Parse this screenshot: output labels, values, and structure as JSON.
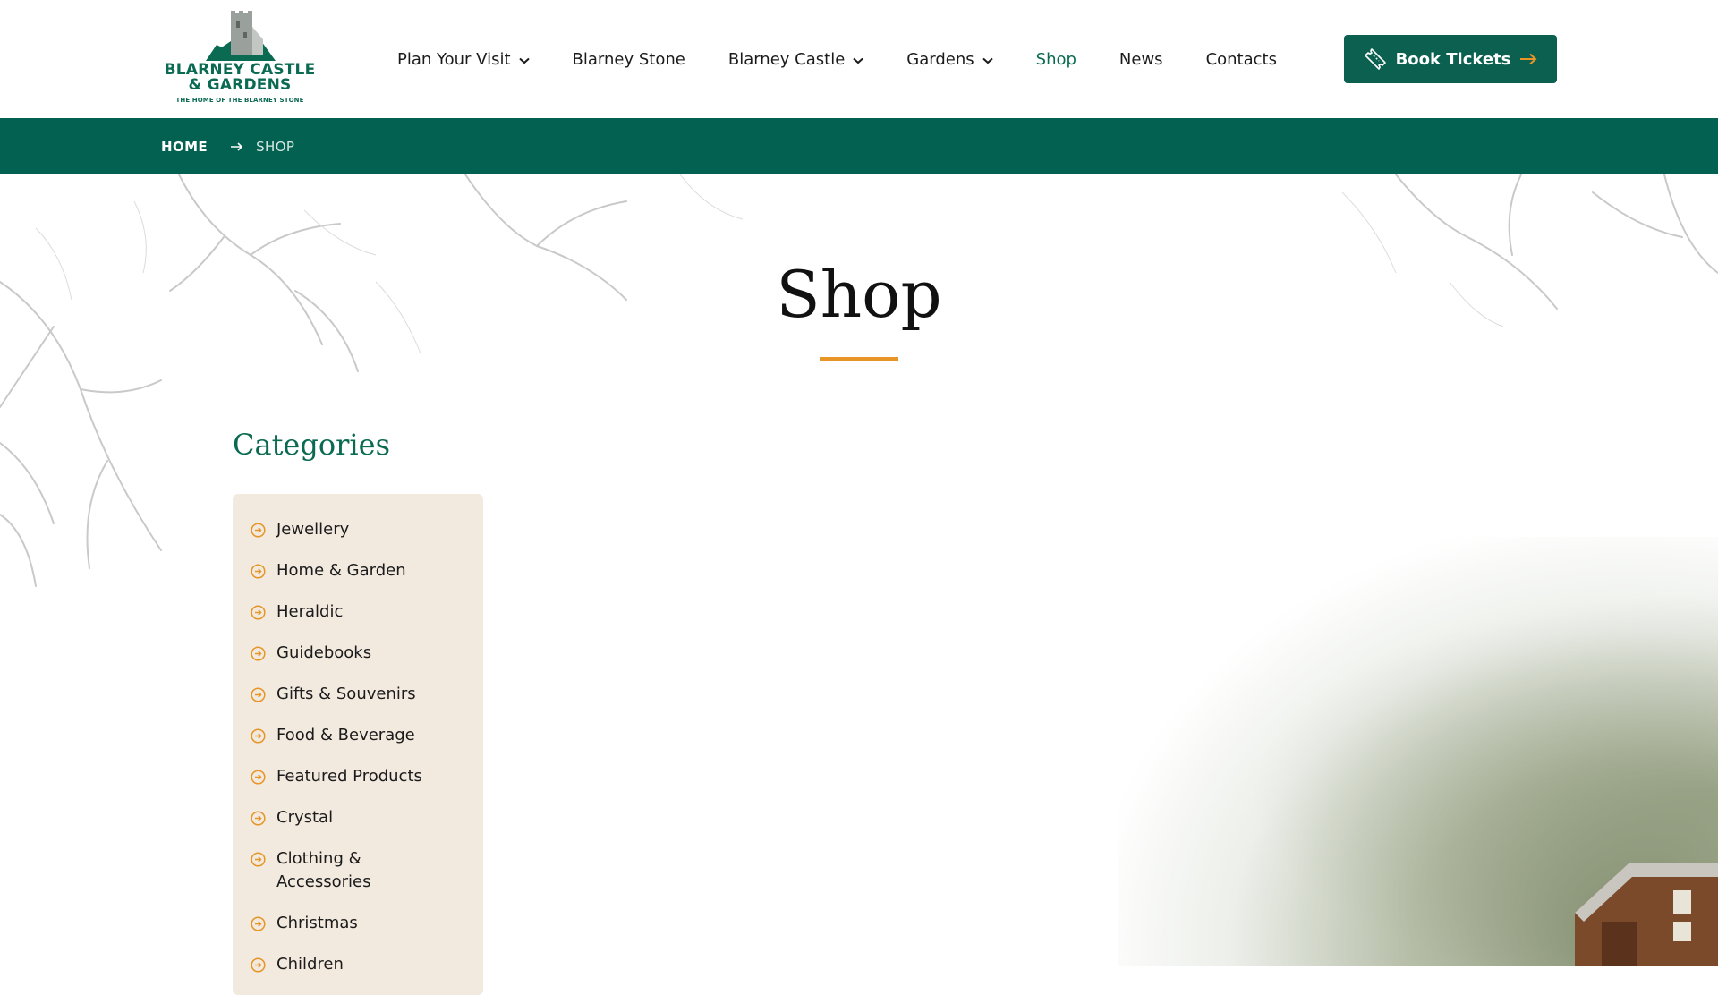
{
  "brand": {
    "name_line1": "BLARNEY CASTLE",
    "name_line2": "& GARDENS",
    "tagline": "THE HOME OF THE BLARNEY STONE",
    "color": "#0b6a52"
  },
  "nav": {
    "items": [
      {
        "label": "Plan Your Visit",
        "has_dropdown": true
      },
      {
        "label": "Blarney Stone",
        "has_dropdown": false
      },
      {
        "label": "Blarney Castle",
        "has_dropdown": true
      },
      {
        "label": "Gardens",
        "has_dropdown": true
      },
      {
        "label": "Shop",
        "has_dropdown": false,
        "active": true
      },
      {
        "label": "News",
        "has_dropdown": false
      },
      {
        "label": "Contacts",
        "has_dropdown": false
      }
    ],
    "cta": {
      "label": "Book Tickets",
      "icon": "ticket-icon",
      "trailing_icon": "arrow-right-icon",
      "color": "#0b6050"
    }
  },
  "breadcrumb": {
    "home": "HOME",
    "current": "SHOP",
    "separator_icon": "arrow-right-icon"
  },
  "page": {
    "title": "Shop",
    "accent": "#e69526"
  },
  "categories": {
    "heading": "Categories",
    "item_icon": "circle-arrow-icon",
    "items": [
      "Jewellery",
      "Home & Garden",
      "Heraldic",
      "Guidebooks",
      "Gifts & Souvenirs",
      "Food & Beverage",
      "Featured Products",
      "Crystal",
      "Clothing & Accessories",
      "Christmas",
      "Children"
    ]
  },
  "colors": {
    "breadcrumb_bar": "#036152",
    "category_panel": "#f2e9df"
  }
}
